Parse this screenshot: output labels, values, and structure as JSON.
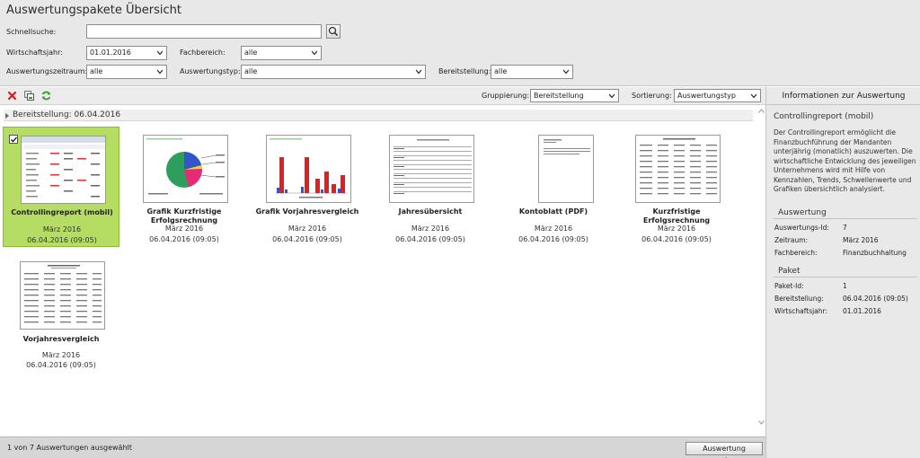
{
  "app_title": "Auswertungspakete Übersicht",
  "filters": {
    "schnellsuche_label": "Schnellsuche:",
    "schnellsuche_value": "",
    "wirtschaftsjahr_label": "Wirtschaftsjahr:",
    "wirtschaftsjahr_value": "01.01.2016",
    "fachbereich_label": "Fachbereich:",
    "fachbereich_value": "alle",
    "zeitraum_label": "Auswertungszeitraum:",
    "zeitraum_value": "alle",
    "typ_label": "Auswertungstyp:",
    "typ_value": "alle",
    "bereitstellung_label": "Bereitstellung:",
    "bereitstellung_value": "alle"
  },
  "toolbar": {
    "gruppierung_label": "Gruppierung:",
    "gruppierung_value": "Bereitstellung",
    "sortierung_label": "Sortierung:",
    "sortierung_value": "Auswertungstyp"
  },
  "group": {
    "label": "Bereitstellung:  06.04.2016"
  },
  "tiles": [
    {
      "name": "Controllingreport (mobil)",
      "month": "März 2016",
      "date": "06.04.2016 (09:05)"
    },
    {
      "name": "Grafik Kurzfristige Erfolgsrechnung",
      "month": "März 2016",
      "date": "06.04.2016 (09:05)"
    },
    {
      "name": "Grafik Vorjahresvergleich",
      "month": "März 2016",
      "date": "06.04.2016 (09:05)"
    },
    {
      "name": "Jahresübersicht",
      "month": "März 2016",
      "date": "06.04.2016 (09:05)"
    },
    {
      "name": "Kontoblatt (PDF)",
      "month": "März 2016",
      "date": "06.04.2016 (09:05)"
    },
    {
      "name": "Kurzfristige Erfolgsrechnung",
      "month": "März 2016",
      "date": "06.04.2016 (09:05)"
    },
    {
      "name": "Vorjahresvergleich",
      "month": "März 2016",
      "date": "06.04.2016 (09:05)"
    }
  ],
  "footer": {
    "status": "1 von 7 Auswertungen ausgewählt",
    "button": "Auswertung anzeigen"
  },
  "info": {
    "title": "Informationen zur Auswertung",
    "name": "Controllingreport (mobil)",
    "description": "Der Controllingreport ermöglicht die Finanzbuchführung der Mandanten unterjährig (monatlich) auszuwerten. Die wirtschaftliche Entwicklung des jeweiligen Unternehmens wird mit Hilfe von Kennzahlen, Trends, Schwellenwerte und Grafiken übersichtlich analysiert.",
    "auswertung_section": "Auswertung",
    "auswertung": [
      {
        "key": "Auswertungs-Id:",
        "value": "7"
      },
      {
        "key": "Zeitraum:",
        "value": "März 2016"
      },
      {
        "key": "Fachbereich:",
        "value": "Finanzbuchhaltung"
      }
    ],
    "paket_section": "Paket",
    "paket": [
      {
        "key": "Paket-Id:",
        "value": "1"
      },
      {
        "key": "Bereitstellung:",
        "value": "06.04.2016 (09:05)"
      },
      {
        "key": "Wirtschaftsjahr:",
        "value": "01.01.2016"
      }
    ]
  },
  "colors": {
    "selected_tile": "#b5dd64",
    "delete_icon": "#cc2222",
    "refresh_icon": "#3a9a2a",
    "pie_green": "#2e9e5e",
    "pie_pink": "#e8297a",
    "pie_blue": "#3355cc",
    "bar_red": "#e02020",
    "bar_blue": "#3355cc"
  }
}
